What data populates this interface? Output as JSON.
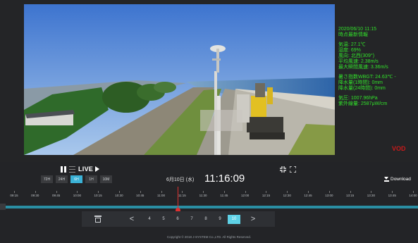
{
  "video": {
    "timestamp": "2020/06/10 11:15",
    "subtitle": "時点最新情報",
    "weather": [
      "気温: 27.1℃",
      "湿度: 69%",
      "風向: 北西(309°)",
      "平均風速: 2.38m/s",
      "最大瞬間風速: 3.36m/s"
    ],
    "indices": [
      "暑さ指数WBGT: 24.63℃ -",
      "降水量(1時間): 0mm",
      "降水量(24時間): 0mm"
    ],
    "pressure": [
      "気圧: 1007.96hPa",
      "紫外線量: 2587μW/cm"
    ],
    "mode_label": "VOD",
    "colors": {
      "overlay_text": "#31e02a",
      "mode_label": "#c81a1a"
    }
  },
  "controls": {
    "pause_icon": "pause-icon",
    "menu_icon": "menu-icon",
    "live_label": "LIVE",
    "play_icon": "play-icon",
    "ranges": [
      "72H",
      "24H",
      "6H",
      "1H",
      "10M"
    ],
    "active_range": "6H",
    "date": "6月10日 (水)",
    "time": "11:16:09",
    "download_label": "Download",
    "accent_color": "#3bb2d6"
  },
  "timeline": {
    "ticks": [
      "09:15",
      "09:30",
      "09:45",
      "10:00",
      "10:15",
      "10:30",
      "10:45",
      "11:00",
      "11:15",
      "11:30",
      "11:45",
      "12:00",
      "12:15",
      "12:30",
      "12:45",
      "13:00",
      "13:15",
      "13:30",
      "13:45",
      "14:00"
    ],
    "cursor_time": "11:16"
  },
  "pager": {
    "prev": "<",
    "next": ">",
    "pages": [
      "4",
      "5",
      "6",
      "7",
      "8",
      "9",
      "10"
    ],
    "active_page": "10"
  },
  "footer": {
    "copyright": "Copyright © 2018 J-SYSTEM Co.,LTD. All Rights Reserved."
  }
}
